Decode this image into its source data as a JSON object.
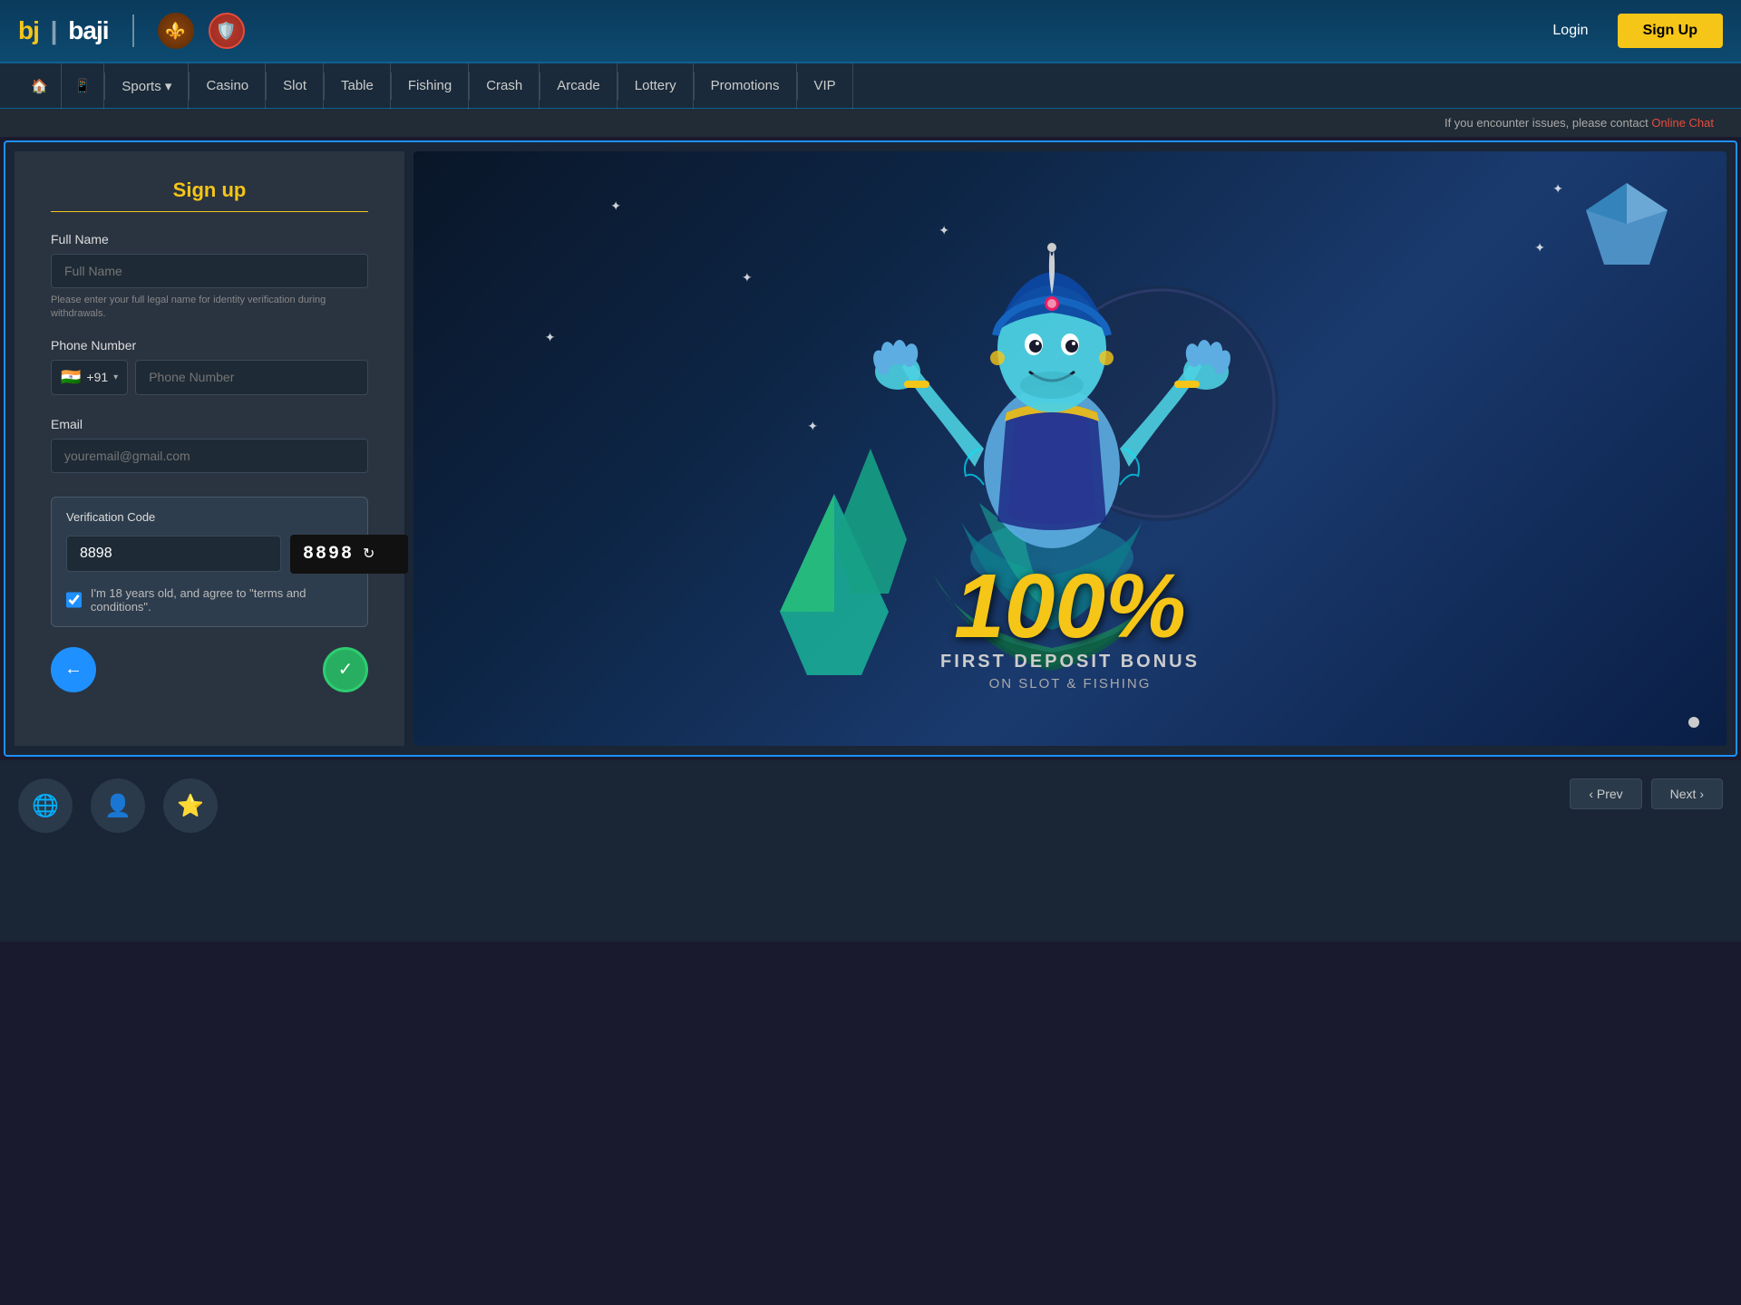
{
  "brand": {
    "logo_bj": "bj",
    "logo_baji": "baji",
    "divider": "|"
  },
  "header": {
    "login_label": "Login",
    "signup_label": "Sign Up"
  },
  "nav": {
    "home_icon": "🏠",
    "phone_icon": "📱",
    "items": [
      {
        "label": "Sports",
        "has_dropdown": true
      },
      {
        "label": "Casino"
      },
      {
        "label": "Slot"
      },
      {
        "label": "Table"
      },
      {
        "label": "Fishing"
      },
      {
        "label": "Crash"
      },
      {
        "label": "Arcade"
      },
      {
        "label": "Lottery"
      },
      {
        "label": "Promotions"
      },
      {
        "label": "VIP"
      }
    ]
  },
  "notice": {
    "text": "If you encounter issues, please contact",
    "contact_label": "Online Chat"
  },
  "signup_form": {
    "title": "Sign up",
    "full_name_label": "Full Name",
    "full_name_placeholder": "Full Name",
    "full_name_hint": "Please enter your full legal name for identity verification during withdrawals.",
    "phone_label": "Phone Number",
    "phone_country_code": "+91",
    "phone_flag": "🇮🇳",
    "phone_placeholder": "Phone Number",
    "email_label": "Email",
    "email_placeholder": "youremail@gmail.com",
    "verification_label": "Verification Code",
    "verification_input_value": "8898",
    "captcha_value": "8898",
    "terms_text": "I'm 18 years old, and agree to \"terms and conditions\".",
    "terms_checked": true,
    "back_icon": "←",
    "confirm_icon": "✓",
    "refresh_icon": "↻"
  },
  "banner": {
    "bonus_percent": "100%",
    "line1": "FIRST DEPOSIT BONUS",
    "line2": "ON SLOT & FISHING"
  },
  "footer": {
    "icons": [
      "🌐",
      "👤",
      "⭐"
    ]
  }
}
